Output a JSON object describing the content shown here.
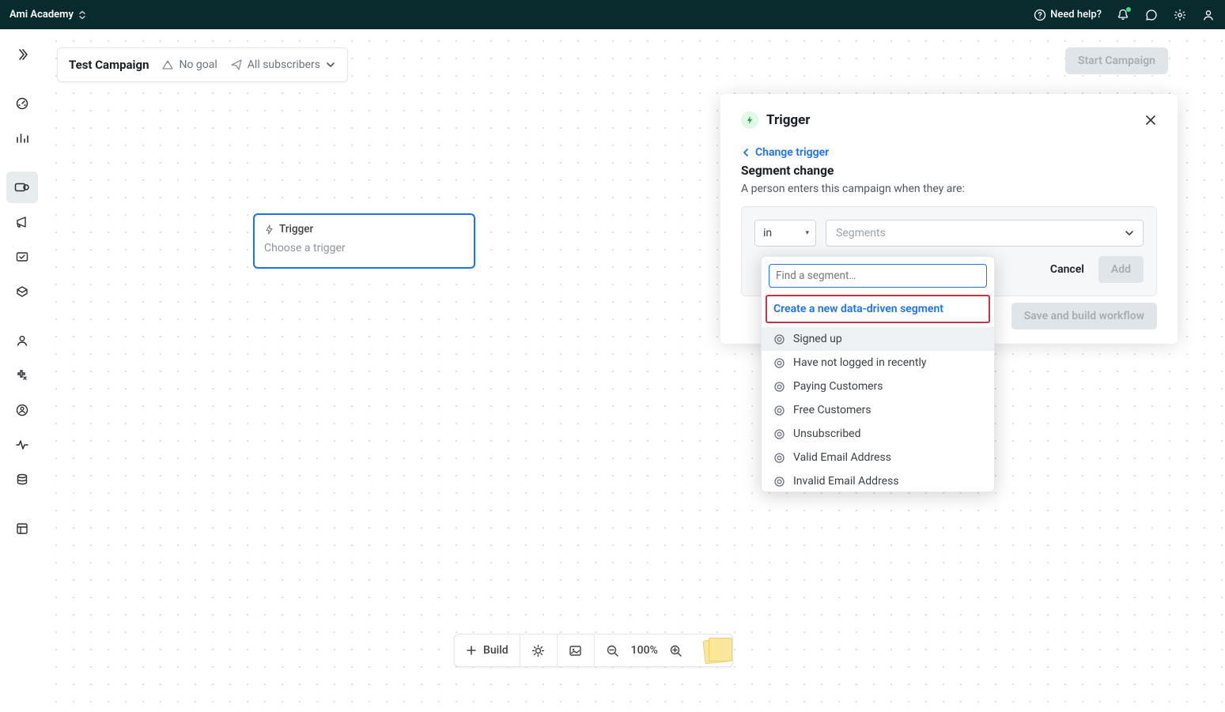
{
  "topbar": {
    "title": "Ami Academy",
    "help": "Need help?"
  },
  "header": {
    "campaign_name": "Test Campaign",
    "goal_label": "No goal",
    "audience_label": "All subscribers",
    "start_button": "Start Campaign"
  },
  "trigger_node": {
    "title": "Trigger",
    "placeholder": "Choose a trigger"
  },
  "panel": {
    "title": "Trigger",
    "change_link": "Change trigger",
    "section_title": "Segment change",
    "description": "A person enters this campaign when they are:",
    "in_label": "in",
    "segments_placeholder": "Segments",
    "cancel": "Cancel",
    "add": "Add",
    "save_button": "Save and build workflow"
  },
  "dropdown": {
    "search_placeholder": "Find a segment…",
    "create_label": "Create a new data-driven segment",
    "options": [
      "Signed up",
      "Have not logged in recently",
      "Paying Customers",
      "Free Customers",
      "Unsubscribed",
      "Valid Email Address",
      "Invalid Email Address"
    ]
  },
  "bottom_toolbar": {
    "build": "Build",
    "zoom": "100%"
  }
}
